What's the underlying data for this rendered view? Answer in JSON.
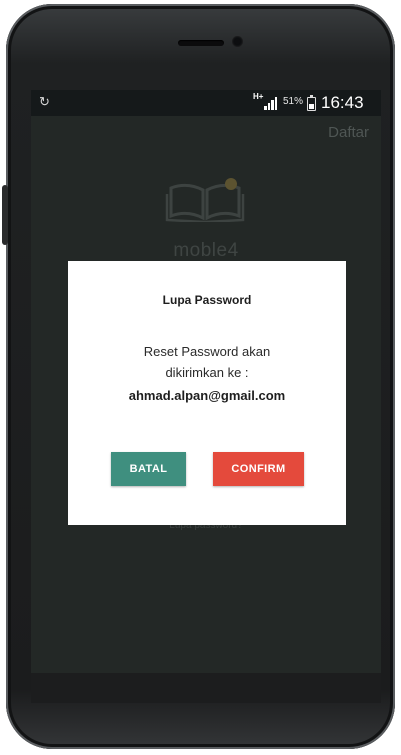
{
  "status_bar": {
    "network_type": "H+",
    "battery_percent": "51%",
    "time": "16:43",
    "icons": [
      "sync-icon",
      "signal-icon",
      "battery-icon"
    ]
  },
  "background": {
    "register_link": "Daftar",
    "app_name": "moble4",
    "forgot_link": "Lupa password?"
  },
  "dialog": {
    "title": "Lupa Password",
    "message_line1": "Reset Password akan",
    "message_line2": "dikirimkan ke :",
    "email": "ahmad.alpan@gmail.com",
    "cancel_label": "BATAL",
    "confirm_label": "CONFIRM"
  },
  "colors": {
    "cancel_button": "#3f8f7f",
    "confirm_button": "#e44a3c",
    "screen_background": "#232826",
    "dialog_background": "#ffffff"
  }
}
